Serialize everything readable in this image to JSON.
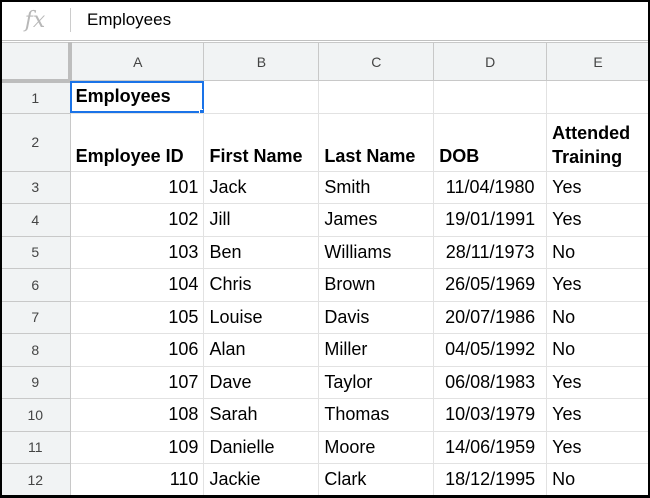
{
  "formula_bar": {
    "icon": "fx",
    "value": "Employees"
  },
  "columns": [
    "A",
    "B",
    "C",
    "D",
    "E"
  ],
  "title": "Employees",
  "headers": [
    "Employee ID",
    "First Name",
    "Last Name",
    "DOB",
    "Attended Training"
  ],
  "rows": [
    [
      "101",
      "Jack",
      "Smith",
      "11/04/1980",
      "Yes"
    ],
    [
      "102",
      "Jill",
      "James",
      "19/01/1991",
      "Yes"
    ],
    [
      "103",
      "Ben",
      "Williams",
      "28/11/1973",
      "No"
    ],
    [
      "104",
      "Chris",
      "Brown",
      "26/05/1969",
      "Yes"
    ],
    [
      "105",
      "Louise",
      "Davis",
      "20/07/1986",
      "No"
    ],
    [
      "106",
      "Alan",
      "Miller",
      "04/05/1992",
      "No"
    ],
    [
      "107",
      "Dave",
      "Taylor",
      "06/08/1983",
      "Yes"
    ],
    [
      "108",
      "Sarah",
      "Thomas",
      "10/03/1979",
      "Yes"
    ],
    [
      "109",
      "Danielle",
      "Moore",
      "14/06/1959",
      "Yes"
    ],
    [
      "110",
      "Jackie",
      "Clark",
      "18/12/1995",
      "No"
    ]
  ],
  "row_numbers": [
    "1",
    "2",
    "3",
    "4",
    "5",
    "6",
    "7",
    "8",
    "9",
    "10",
    "11",
    "12"
  ],
  "selection_color": "#1a73e8"
}
